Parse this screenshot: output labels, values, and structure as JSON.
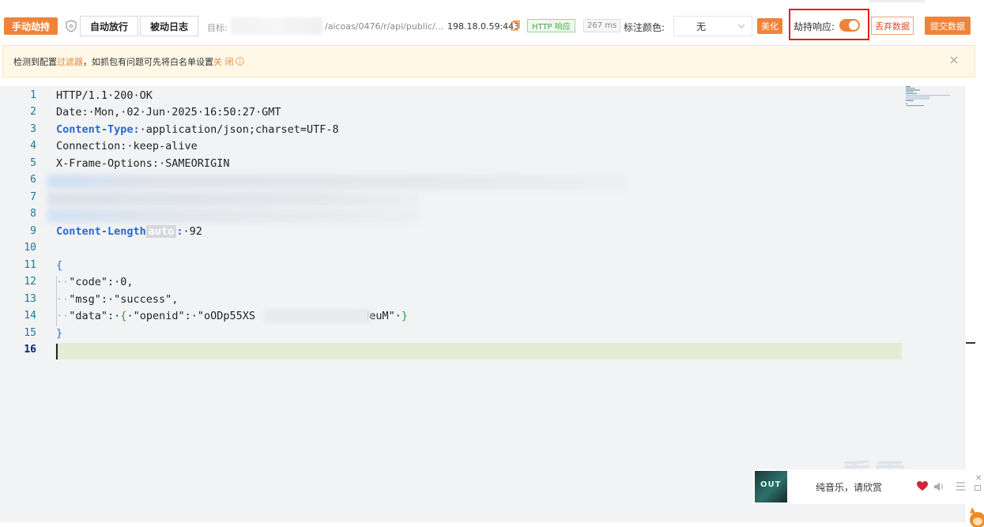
{
  "toolbar": {
    "manual_hijack": "手动劫持",
    "auto_release": "自动放行",
    "passive_log": "被动日志",
    "target_label": "目标:",
    "target_url": "/aicoas/0476/r/api/public/...",
    "ip": "198.18.0.59:443",
    "http_tag": "HTTP 响应",
    "time_tag": "267 ms",
    "color_label": "标注颜色:",
    "color_value": "无",
    "beautify": "美化",
    "hijack_response_label": "劫持响应:",
    "hijack_response_on": true,
    "discard": "丢弃数据",
    "submit": "提交数据"
  },
  "warning": {
    "text_before": "检测到配置",
    "link_filter": "过滤器",
    "text_middle": "，如抓包有问题可先将白名单设置",
    "link_close": "关 闭"
  },
  "editor": {
    "line_numbers": [
      "1",
      "2",
      "3",
      "4",
      "5",
      "6",
      "7",
      "8",
      "9",
      "10",
      "11",
      "12",
      "13",
      "14",
      "15",
      "16"
    ],
    "active_line": 16,
    "l1": "HTTP/1.1·200·OK",
    "l2": "Date:·Mon,·02·Jun·2025·16:50:27·GMT",
    "l3_key": "Content-Type:",
    "l3_val": "·application/json;charset=UTF-8",
    "l4": "Connection:·keep-alive",
    "l5": "X-Frame-Options:·SAMEORIGIN",
    "l9_key": "Content-Length",
    "l9_chip": "auto",
    "l9_colon": ":",
    "l9_val": "·92",
    "l11": "{",
    "l12_ws": "··",
    "l12": "\"code\":·0,",
    "l13_ws": "··",
    "l13": "\"msg\":·\"success\",",
    "l14_ws": "··",
    "l14_a": "\"data\":·",
    "l14_b": "{",
    "l14_c": "·\"openid\":·\"oODp55XS",
    "l14_d": "bUeuM\"·",
    "l14_e": "}",
    "l15": "}"
  },
  "music": {
    "album_text": "OUT",
    "title": "纯音乐，请欣赏"
  },
  "watermark": "看雪",
  "colors": {
    "accent": "#f0833a",
    "danger": "#e0201a",
    "keyword": "#2b69c9"
  }
}
